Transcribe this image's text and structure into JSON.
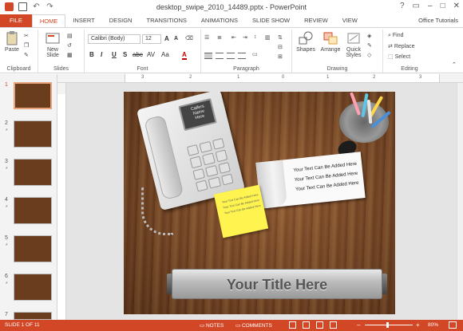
{
  "window": {
    "title": "desktop_swipe_2010_14489.pptx - PowerPoint",
    "controls": [
      "?",
      "▭",
      "–",
      "□",
      "✕"
    ]
  },
  "qat": {
    "undo": "↶",
    "redo": "↷"
  },
  "tabs": [
    "FILE",
    "HOME",
    "INSERT",
    "DESIGN",
    "TRANSITIONS",
    "ANIMATIONS",
    "SLIDE SHOW",
    "REVIEW",
    "VIEW"
  ],
  "active_tab": "HOME",
  "account": "Office Tutorials",
  "ribbon": {
    "clipboard": {
      "label": "Clipboard",
      "paste": "Paste"
    },
    "slides": {
      "label": "Slides",
      "new_slide": "New",
      "new_slide2": "Slide"
    },
    "font": {
      "label": "Font",
      "family": "Calibri (Body)",
      "size": "12",
      "grow": "A",
      "shrink": "A",
      "bold": "B",
      "italic": "I",
      "underline": "U",
      "shadow": "S",
      "strike": "abc",
      "spacing": "AV",
      "case": "Aa",
      "color": "A"
    },
    "paragraph": {
      "label": "Paragraph"
    },
    "drawing": {
      "label": "Drawing",
      "shapes": "Shapes",
      "arrange": "Arrange",
      "quick_styles": "Quick",
      "quick_styles2": "Styles"
    },
    "editing": {
      "label": "Editing",
      "find": "Find",
      "replace": "Replace",
      "select": "Select"
    }
  },
  "thumbnails": [
    {
      "num": "1",
      "star": ""
    },
    {
      "num": "2",
      "star": "*"
    },
    {
      "num": "3",
      "star": "*"
    },
    {
      "num": "4",
      "star": "*"
    },
    {
      "num": "5",
      "star": "*"
    },
    {
      "num": "6",
      "star": "*"
    },
    {
      "num": "7",
      "star": ""
    }
  ],
  "ruler": {
    "ticks": [
      "3",
      "2",
      "1",
      "0",
      "1",
      "2",
      "3"
    ]
  },
  "slide": {
    "title": "Your Title Here",
    "phone_screen": [
      "Callers",
      "Name",
      "Here"
    ],
    "paper_lines": [
      "Your Text Can Be Added Here",
      "Your Text Can Be Added Here",
      "Your Text Can Be Added Here"
    ],
    "sticky_lines": [
      "Your Text Can Be Added Here",
      "Your Text Can Be Added Here",
      "Your Text Can Be Added Here"
    ]
  },
  "status": {
    "slide_info": "SLIDE 1 OF 11",
    "notes": "NOTES",
    "comments": "COMMENTS",
    "zoom_minus": "–",
    "zoom_plus": "+",
    "zoom": "80%",
    "zoom_level": 0.45
  },
  "colors": {
    "accent": "#d24726"
  }
}
